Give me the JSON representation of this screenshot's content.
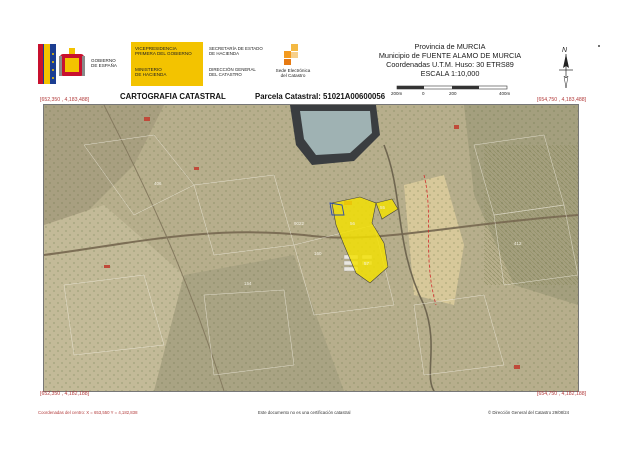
{
  "header": {
    "gov_line1": "GOBIERNO",
    "gov_line2": "DE ESPAÑA",
    "vice_line1": "VICEPRESIDENCIA",
    "vice_line2": "PRIMERA DEL GOBIERNO",
    "min_line1": "MINISTERIO",
    "min_line2": "DE HACIENDA",
    "sec_line1": "SECRETARÍA DE ESTADO",
    "sec_line2": "DE HACIENDA",
    "dir_line1": "DIRECCIÓN GENERAL",
    "dir_line2": "DEL CATASTRO",
    "sede_line1": "Sede Electrónica",
    "sede_line2": "del Catastro"
  },
  "province": {
    "line1": "Provincia de MURCIA",
    "line2": "Municipio de FUENTE ALAMO DE MURCIA",
    "line3": "Coordenadas U.T.M. Huso: 30 ETRS89",
    "line4": "ESCALA 1:10,000"
  },
  "scale": {
    "labels": [
      "200m",
      "0",
      "200",
      "400m"
    ]
  },
  "north": {
    "label": "N"
  },
  "titles": {
    "left": "CARTOGRAFIA CATASTRAL",
    "right": "Parcela Catastral: 51021A00600056"
  },
  "coords": {
    "top_left": "[652,350 , 4,183,488]",
    "top_right": "[654,750 , 4,183,488]",
    "bottom_left": "[652,350 , 4,182,188]",
    "bottom_right": "[654,750 , 4,182,188]"
  },
  "footer": {
    "left": "Coordenadas del centro: X = 653,550 Y = 4,182,838",
    "center": "Este documento no es una certificación catastral",
    "right": "© Dirección General del Catastro 29/08/24"
  },
  "colors": {
    "yellow_parcel": "#f5e200",
    "coord_red": "#b23a3a",
    "gov_yellow": "#f3c300"
  },
  "map_labels": [
    "56",
    "55",
    "57",
    "160",
    "9022",
    "154",
    "406",
    "412"
  ]
}
